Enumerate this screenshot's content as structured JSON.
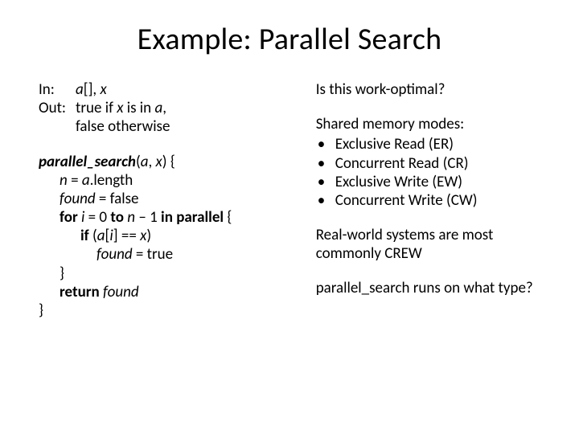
{
  "title": "Example: Parallel Search",
  "left": {
    "spec": {
      "in_label": "In:",
      "in_val_pre": "a",
      "in_val_post": "[], ",
      "in_val_x": "x",
      "out_label": "Out:",
      "out_line1_pre": "true if ",
      "out_line1_x": "x",
      "out_line1_mid": " is in ",
      "out_line1_a": "a",
      "out_line1_post": ",",
      "out_line2": "false otherwise"
    },
    "code": {
      "l1_name": "parallel_search",
      "l1_open": "(",
      "l1_a": "a",
      "l1_sep": ", ",
      "l1_x": "x",
      "l1_close": ") {",
      "l2_n": "n",
      "l2_eq": " = ",
      "l2_a": "a",
      "l2_len": ".length",
      "l3_found": "found",
      "l3_rest": " = false",
      "l4_for": "for",
      "l4_sp1": " ",
      "l4_i": "i",
      "l4_mid1": " = 0 ",
      "l4_to": "to",
      "l4_sp2": " ",
      "l4_n": "n",
      "l4_mid2": " – 1 ",
      "l4_inpar": "in parallel",
      "l4_brace": " {",
      "l5_if": "if",
      "l5_sp": " (",
      "l5_a": "a",
      "l5_br": "[",
      "l5_i": "i",
      "l5_mid": "] == ",
      "l5_x": "x",
      "l5_close": ")",
      "l6_found": "found",
      "l6_rest": " = true",
      "l7": "}",
      "l8_ret": "return",
      "l8_sp": " ",
      "l8_found": "found",
      "l9": "}"
    }
  },
  "right": {
    "q1": "Is this work-optimal?",
    "modes_title": "Shared memory modes:",
    "modes": [
      "Exclusive Read (ER)",
      "Concurrent Read (CR)",
      "Exclusive Write (EW)",
      "Concurrent Write (CW)"
    ],
    "bullet": "•",
    "note1": "Real-world systems are most commonly CREW",
    "note2": "parallel_search runs on what type?"
  }
}
